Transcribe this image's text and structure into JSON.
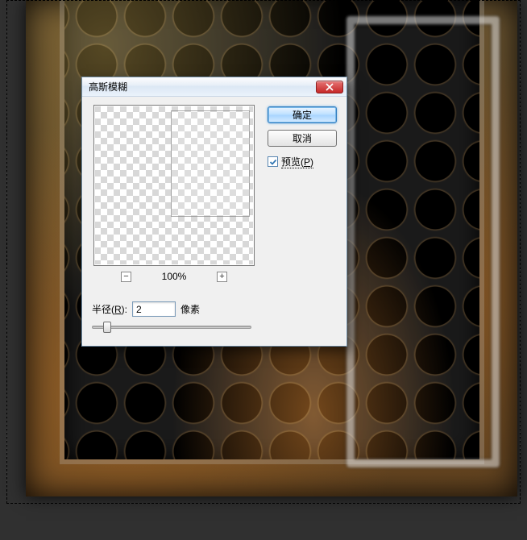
{
  "dialog": {
    "title": "高斯模糊",
    "buttons": {
      "ok": "确定",
      "cancel": "取消"
    },
    "preview": {
      "checked": true,
      "label_prefix": "预览(",
      "label_hotkey": "P",
      "label_suffix": ")"
    },
    "zoom": {
      "minus": "−",
      "plus": "+",
      "level": "100%"
    },
    "radius": {
      "label_prefix": "半径(",
      "label_hotkey": "R",
      "label_suffix": "):",
      "value": "2",
      "unit": "像素"
    },
    "close_icon": "close-icon"
  }
}
